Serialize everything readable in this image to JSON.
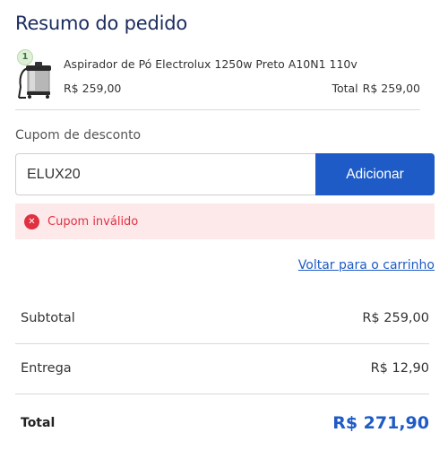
{
  "summary": {
    "title": "Resumo do pedido"
  },
  "item": {
    "quantity": "1",
    "name": "Aspirador de Pó Electrolux 1250w Preto A10N1 110v",
    "price": "R$ 259,00",
    "total_label": "Total",
    "total_value": "R$ 259,00"
  },
  "coupon": {
    "label": "Cupom de desconto",
    "value": "ELUX20",
    "button_label": "Adicionar",
    "error_text": "Cupom inválido"
  },
  "back_link": "Voltar para o carrinho",
  "totals": {
    "subtotal_label": "Subtotal",
    "subtotal_value": "R$ 259,00",
    "shipping_label": "Entrega",
    "shipping_value": "R$ 12,90",
    "total_label": "Total",
    "total_value": "R$ 271,90"
  },
  "colors": {
    "accent": "#1e5bc6",
    "title": "#1a2b5e",
    "error": "#e03141",
    "error_bg": "#fde8ea"
  }
}
